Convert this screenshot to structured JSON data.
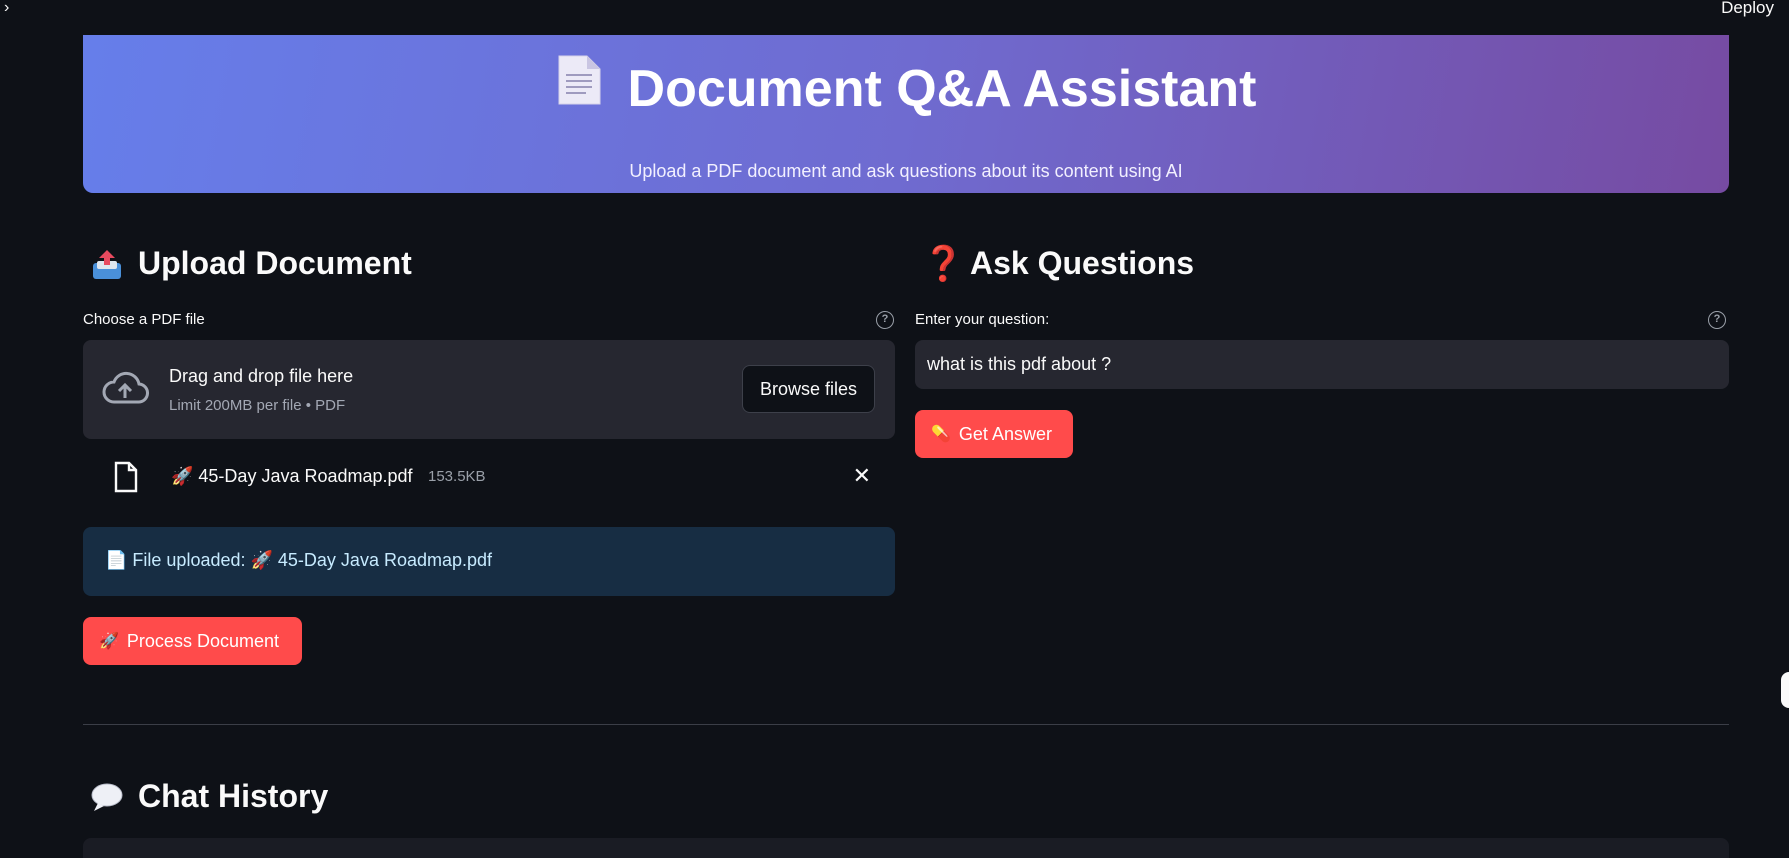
{
  "topbar": {
    "deploy_label": "Deploy",
    "sidebar_toggle": "›"
  },
  "hero": {
    "title": "Document Q&A Assistant",
    "subtitle": "Upload a PDF document and ask questions about its content using AI"
  },
  "upload": {
    "heading": "Upload Document",
    "file_label": "Choose a PDF file",
    "dropzone_title": "Drag and drop file here",
    "dropzone_limit": "Limit 200MB per file • PDF",
    "browse_label": "Browse files",
    "file": {
      "name": "🚀 45-Day Java Roadmap.pdf",
      "size": "153.5KB"
    },
    "info_text": "📄 File uploaded: 🚀 45-Day Java Roadmap.pdf",
    "process_label": "Process Document"
  },
  "ask": {
    "heading": "Ask Questions",
    "question_label": "Enter your question:",
    "question_value": "what is this pdf about ?",
    "answer_label": "Get Answer"
  },
  "chat": {
    "heading": "Chat History"
  },
  "colors": {
    "background": "#0e1117",
    "hero_gradient_start": "#667eea",
    "hero_gradient_end": "#764ba2",
    "primary_button": "#ff4b4b",
    "info_box": "#172d43",
    "input_bg": "#262730"
  },
  "icons": {
    "hero": "document-icon",
    "upload": "outbox-tray-icon",
    "ask": "question-mark-icon",
    "chat": "speech-bubble-icon",
    "process": "rocket-icon",
    "answer": "pill-icon"
  }
}
